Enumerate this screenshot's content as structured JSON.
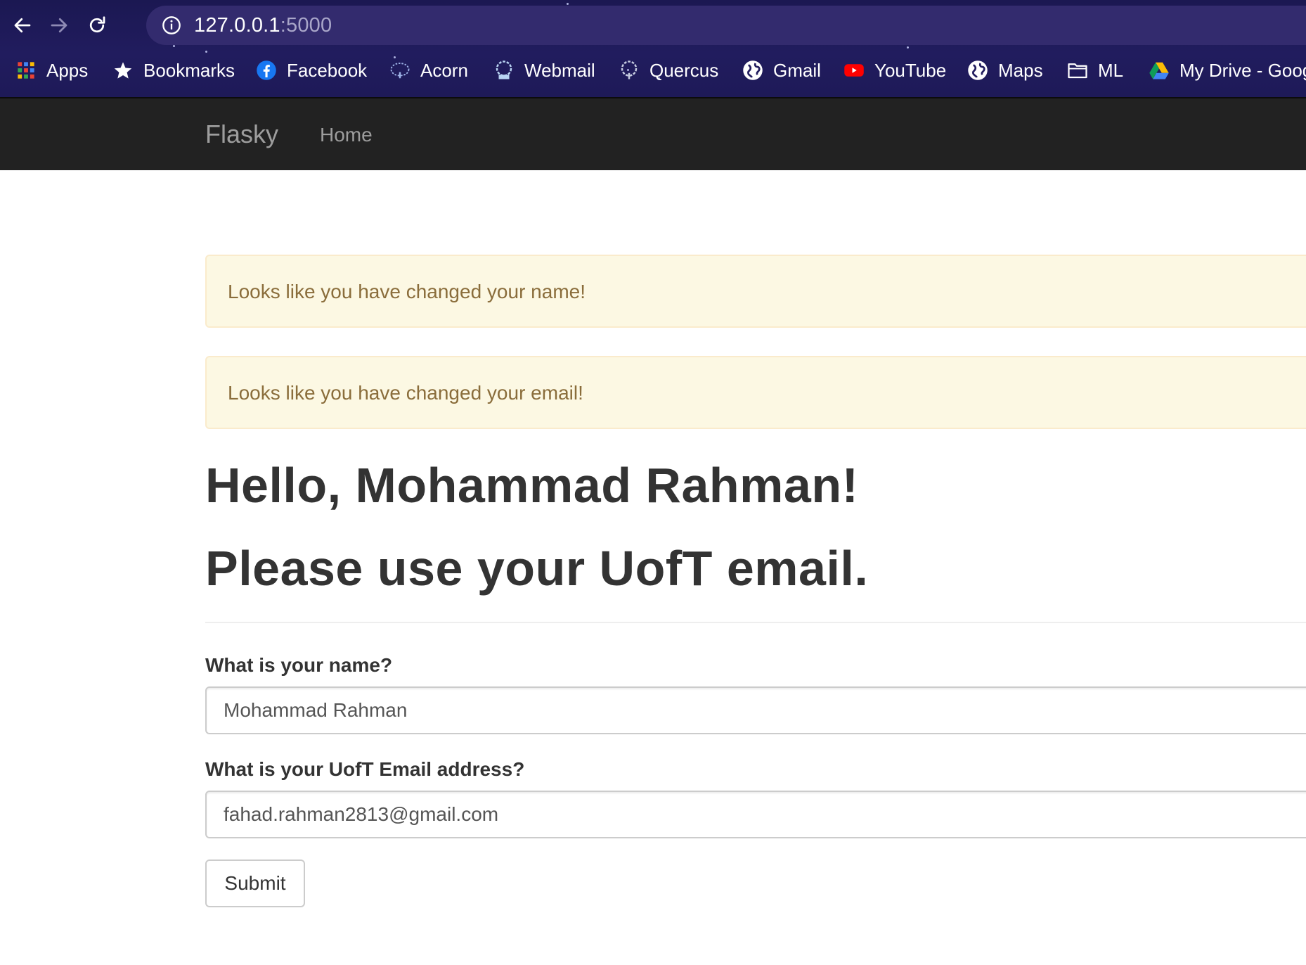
{
  "browser": {
    "url_host": "127.0.0.1",
    "url_port": ":5000",
    "bookmarks": [
      {
        "label": "Apps",
        "icon": "apps-grid-icon"
      },
      {
        "label": "Bookmarks",
        "icon": "star-icon"
      },
      {
        "label": "Facebook",
        "icon": "facebook-icon"
      },
      {
        "label": "Acorn",
        "icon": "acorn-icon"
      },
      {
        "label": "Webmail",
        "icon": "webmail-icon"
      },
      {
        "label": "Quercus",
        "icon": "quercus-icon"
      },
      {
        "label": "Gmail",
        "icon": "globe-icon"
      },
      {
        "label": "YouTube",
        "icon": "youtube-icon"
      },
      {
        "label": "Maps",
        "icon": "globe-icon"
      },
      {
        "label": "ML",
        "icon": "folder-icon"
      },
      {
        "label": "My Drive - Goog",
        "icon": "drive-icon"
      }
    ]
  },
  "navbar": {
    "brand": "Flasky",
    "home": "Home"
  },
  "alerts": [
    {
      "message": "Looks like you have changed your name!"
    },
    {
      "message": "Looks like you have changed your email!"
    }
  ],
  "main": {
    "greeting": "Hello, Mohammad Rahman!",
    "instruction": "Please use your UofT email."
  },
  "form": {
    "name_label": "What is your name?",
    "name_value": "Mohammad Rahman",
    "email_label": "What is your UofT Email address?",
    "email_value": "fahad.rahman2813@gmail.com",
    "submit_label": "Submit"
  },
  "colors": {
    "chrome_bg": "#1e1a58",
    "navbar_bg": "#222222",
    "alert_bg": "#fcf8e3",
    "alert_text": "#8a6d3b",
    "heading_text": "#333333"
  }
}
